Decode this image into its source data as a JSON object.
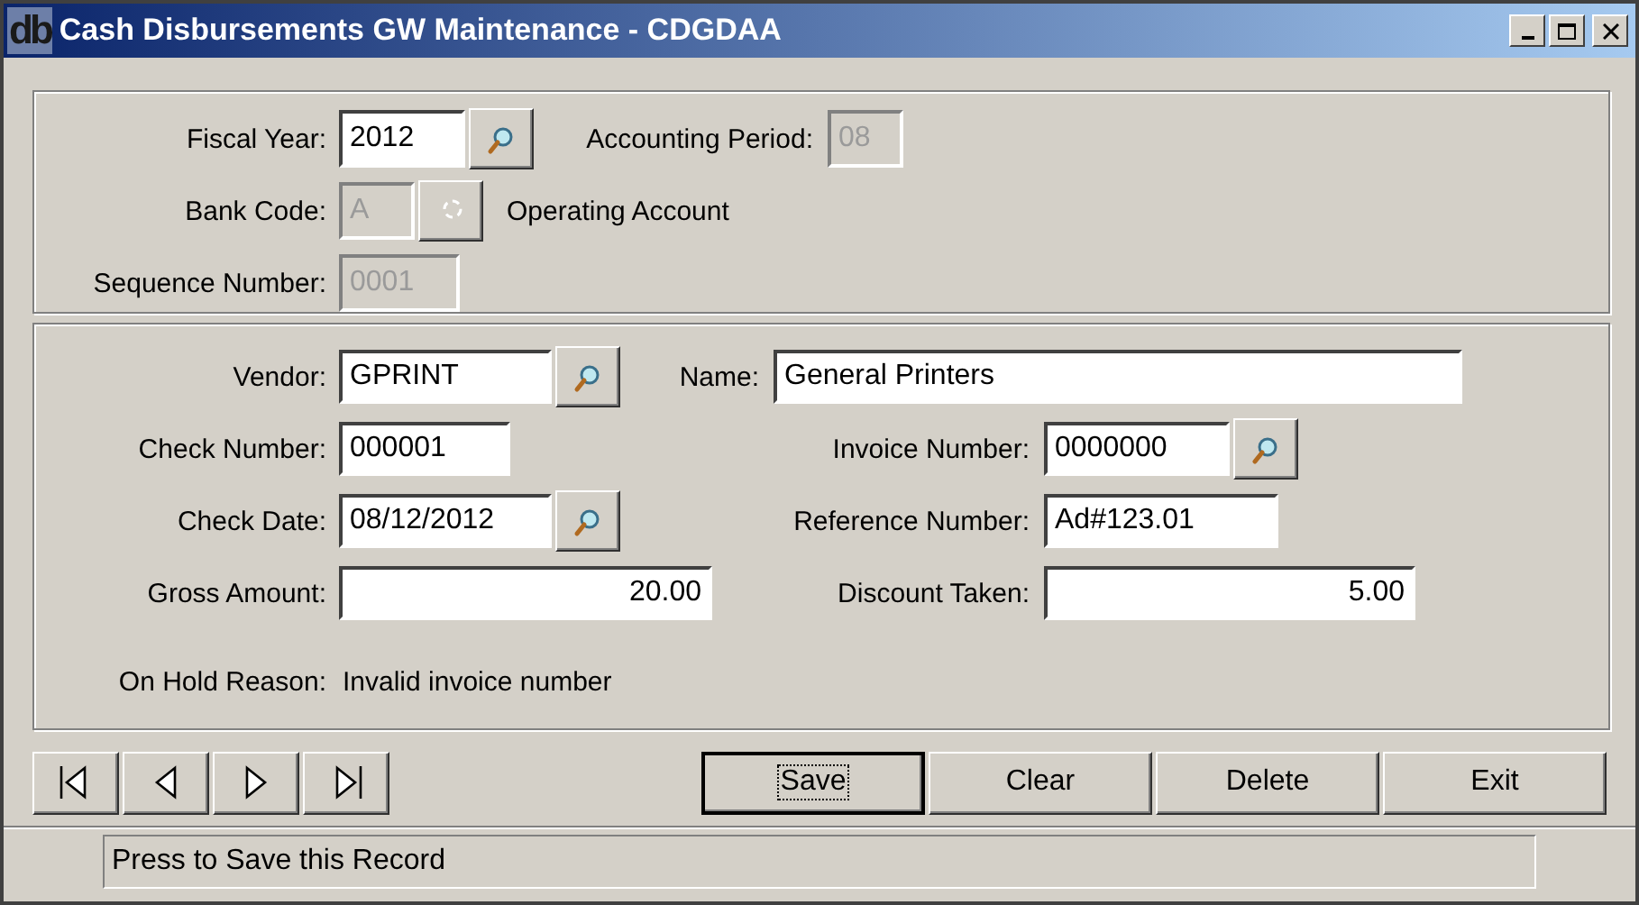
{
  "window": {
    "icon_text": "db",
    "title": "Cash Disbursements GW Maintenance - CDGDAA"
  },
  "panels": [
    {
      "rows": [
        [
          {
            "kind": "field",
            "label": "Fiscal Year:",
            "value": "2012",
            "disabled": false,
            "lookup": {
              "disabled": false
            }
          },
          {
            "kind": "field",
            "label": "Accounting Period:",
            "value": "08",
            "disabled": true
          }
        ],
        [
          {
            "kind": "field",
            "label": "Bank Code:",
            "value": "A",
            "disabled": true,
            "lookup": {
              "disabled": true
            }
          },
          {
            "kind": "note",
            "text": "Operating Account"
          }
        ],
        [
          {
            "kind": "field",
            "label": "Sequence Number:",
            "value": "0001",
            "disabled": true
          }
        ]
      ]
    },
    {
      "rows": [
        [
          {
            "kind": "field",
            "label": "Vendor:",
            "value": "GPRINT",
            "disabled": false,
            "lookup": {
              "disabled": false
            }
          },
          {
            "kind": "field",
            "label": "Name:",
            "value": "General Printers",
            "disabled": false
          }
        ],
        [
          {
            "kind": "field",
            "label": "Check Number:",
            "value": "000001",
            "disabled": false
          },
          {
            "kind": "field",
            "label": "Invoice Number:",
            "value": "0000000",
            "disabled": false,
            "lookup": {
              "disabled": false
            }
          }
        ],
        [
          {
            "kind": "field",
            "label": "Check Date:",
            "value": "08/12/2012",
            "disabled": false,
            "lookup": {
              "disabled": false
            }
          },
          {
            "kind": "field",
            "label": "Reference Number:",
            "value": "Ad#123.01",
            "disabled": false
          }
        ],
        [
          {
            "kind": "amount",
            "label": "Gross Amount:",
            "value": "20.00",
            "disabled": false
          },
          {
            "kind": "amount",
            "label": "Discount Taken:",
            "value": "5.00",
            "disabled": false
          }
        ],
        [
          {
            "kind": "readout",
            "label": "On Hold Reason:",
            "text": "Invalid invoice number"
          }
        ]
      ]
    }
  ],
  "nav_buttons": [
    {
      "kind": "first"
    },
    {
      "kind": "previous"
    },
    {
      "kind": "next"
    },
    {
      "kind": "last"
    }
  ],
  "action_buttons": [
    {
      "label": "Save",
      "selected": true
    },
    {
      "label": "Clear",
      "selected": false
    },
    {
      "label": "Delete",
      "selected": false
    },
    {
      "label": "Exit",
      "selected": false
    }
  ],
  "status_bar": {
    "text": "Press to Save this Record"
  }
}
